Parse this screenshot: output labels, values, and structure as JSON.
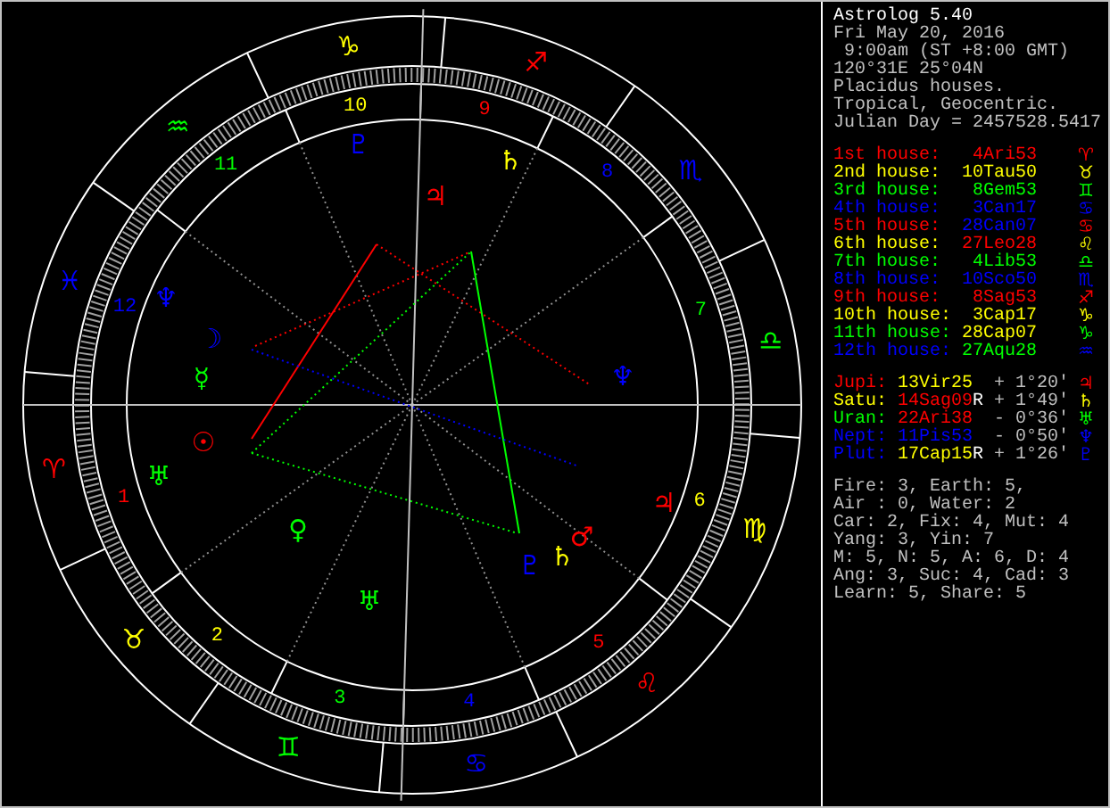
{
  "chart": {
    "signs": [
      {
        "glyph": "♈",
        "color": "#ff0000"
      },
      {
        "glyph": "♉",
        "color": "#ffff00"
      },
      {
        "glyph": "♊",
        "color": "#00ff00"
      },
      {
        "glyph": "♋",
        "color": "#0000ff"
      },
      {
        "glyph": "♌",
        "color": "#ff0000"
      },
      {
        "glyph": "♍",
        "color": "#ffff00"
      },
      {
        "glyph": "♎",
        "color": "#00ff00"
      },
      {
        "glyph": "♏",
        "color": "#0000ff"
      },
      {
        "glyph": "♐",
        "color": "#ff0000"
      },
      {
        "glyph": "♑",
        "color": "#ffff00"
      },
      {
        "glyph": "♒",
        "color": "#00ff00"
      },
      {
        "glyph": "♓",
        "color": "#0000ff"
      }
    ],
    "house_numbers": [
      {
        "label": "1",
        "color": "#ff0000"
      },
      {
        "label": "2",
        "color": "#ffff00"
      },
      {
        "label": "3",
        "color": "#00ff00"
      },
      {
        "label": "4",
        "color": "#0000ff"
      },
      {
        "label": "5",
        "color": "#ff0000"
      },
      {
        "label": "6",
        "color": "#ffff00"
      },
      {
        "label": "7",
        "color": "#00ff00"
      },
      {
        "label": "8",
        "color": "#0000ff"
      },
      {
        "label": "9",
        "color": "#ff0000"
      },
      {
        "label": "10",
        "color": "#ffff00"
      },
      {
        "label": "11",
        "color": "#00ff00"
      },
      {
        "label": "12",
        "color": "#0000ff"
      }
    ],
    "planets": [
      {
        "glyph": "☉",
        "color": "#ff0000"
      },
      {
        "glyph": "☽",
        "color": "#0000ff"
      },
      {
        "glyph": "☿",
        "color": "#00ff00"
      },
      {
        "glyph": "♀",
        "color": "#00ff00"
      },
      {
        "glyph": "♅",
        "color": "#00ff00"
      },
      {
        "glyph": "♅",
        "color": "#00ff00"
      },
      {
        "glyph": "♆",
        "color": "#0000ff"
      },
      {
        "glyph": "♆",
        "color": "#0000ff"
      },
      {
        "glyph": "♇",
        "color": "#0000ff"
      },
      {
        "glyph": "♇",
        "color": "#0000ff"
      },
      {
        "glyph": "♃",
        "color": "#ff0000"
      },
      {
        "glyph": "♃",
        "color": "#ff0000"
      },
      {
        "glyph": "♄",
        "color": "#ffff00"
      },
      {
        "glyph": "♄",
        "color": "#ffff00"
      },
      {
        "glyph": "♂",
        "color": "#ff0000"
      }
    ]
  },
  "panel": {
    "title": "Astrolog 5.40",
    "info": [
      "Fri May 20, 2016",
      " 9:00am (ST +8:00 GMT)",
      "120°31E 25°04N",
      "Placidus houses.",
      "Tropical, Geocentric.",
      "Julian Day = 2457528.5417"
    ],
    "houses": [
      {
        "label": "1st house:",
        "color": "#ff0000",
        "position": {
          "text": "4Ari53",
          "color": "#ff0000"
        },
        "glyph": "♈"
      },
      {
        "label": "2nd house:",
        "color": "#ffff00",
        "position": {
          "text": "10Tau50",
          "color": "#ffff00"
        },
        "glyph": "♉"
      },
      {
        "label": "3rd house:",
        "color": "#00ff00",
        "position": {
          "text": "8Gem53",
          "color": "#00ff00"
        },
        "glyph": "♊"
      },
      {
        "label": "4th house:",
        "color": "#0000ff",
        "position": {
          "text": "3Can17",
          "color": "#0000ff"
        },
        "glyph": "♋"
      },
      {
        "label": "5th house:",
        "color": "#ff0000",
        "position": {
          "text": "28Can07",
          "color": "#0000ff"
        },
        "glyph": "♋"
      },
      {
        "label": "6th house:",
        "color": "#ffff00",
        "position": {
          "text": "27Leo28",
          "color": "#ff0000"
        },
        "glyph": "♌"
      },
      {
        "label": "7th house:",
        "color": "#00ff00",
        "position": {
          "text": "4Lib53",
          "color": "#00ff00"
        },
        "glyph": "♎"
      },
      {
        "label": "8th house:",
        "color": "#0000ff",
        "position": {
          "text": "10Sco50",
          "color": "#0000ff"
        },
        "glyph": "♏"
      },
      {
        "label": "9th house:",
        "color": "#ff0000",
        "position": {
          "text": "8Sag53",
          "color": "#ff0000"
        },
        "glyph": "♐"
      },
      {
        "label": "10th house:",
        "color": "#ffff00",
        "position": {
          "text": "3Cap17",
          "color": "#ffff00"
        },
        "glyph": "♑"
      },
      {
        "label": "11th house:",
        "color": "#00ff00",
        "position": {
          "text": "28Cap07",
          "color": "#ffff00"
        },
        "glyph": "♑"
      },
      {
        "label": "12th house:",
        "color": "#0000ff",
        "position": {
          "text": "27Aqu28",
          "color": "#00ff00"
        },
        "glyph": "♒"
      }
    ],
    "planets": [
      {
        "name": "Jupi:",
        "color": "#ff0000",
        "position": {
          "text": "13Vir25",
          "color": "#ffff00"
        },
        "motion": "+ 1°20'",
        "glyph": "♃"
      },
      {
        "name": "Satu:",
        "color": "#ffff00",
        "position": {
          "text": "14Sag09",
          "color": "#ff0000"
        },
        "flag": "R",
        "motion": "+ 1°49'",
        "glyph": "♄"
      },
      {
        "name": "Uran:",
        "color": "#00ff00",
        "position": {
          "text": "22Ari38",
          "color": "#ff0000"
        },
        "motion": "- 0°36'",
        "glyph": "♅"
      },
      {
        "name": "Nept:",
        "color": "#0000ff",
        "position": {
          "text": "11Pis53",
          "color": "#0000ff"
        },
        "motion": "- 0°50'",
        "glyph": "♆"
      },
      {
        "name": "Plut:",
        "color": "#0000ff",
        "position": {
          "text": "17Cap15",
          "color": "#ffff00"
        },
        "flag": "R",
        "motion": "+ 1°26'",
        "glyph": "♇"
      }
    ],
    "stats": [
      "Fire: 3, Earth: 5,",
      "Air : 0, Water: 2",
      "Car: 2, Fix: 4, Mut: 4",
      "Yang: 3, Yin: 7",
      "M: 5, N: 5, A: 6, D: 4",
      "Ang: 3, Suc: 4, Cad: 3",
      "Learn: 5, Share: 5"
    ]
  }
}
